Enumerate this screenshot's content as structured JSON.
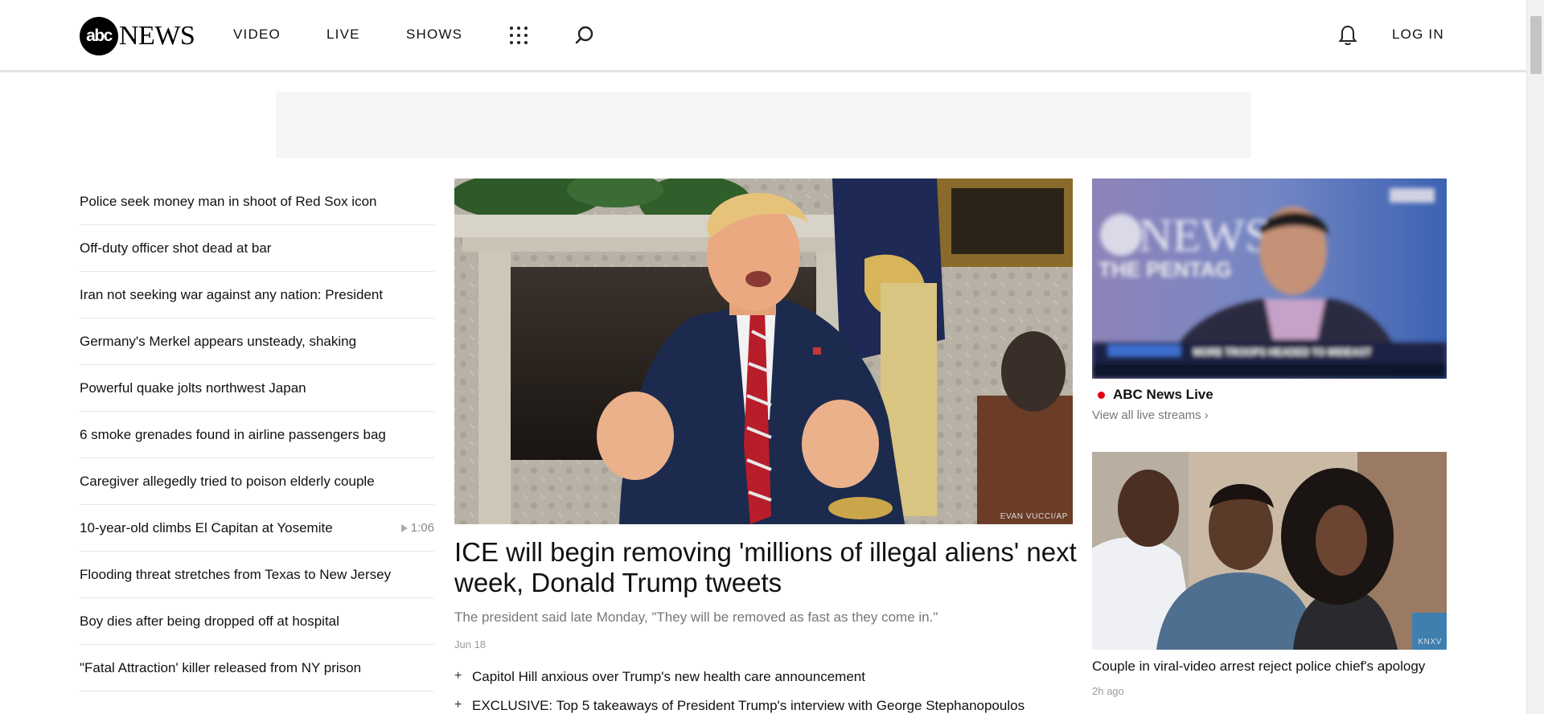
{
  "header": {
    "logo": {
      "circle_text": "abc",
      "wordmark": "NEWS"
    },
    "nav": [
      "VIDEO",
      "LIVE",
      "SHOWS"
    ],
    "login_label": "LOG IN"
  },
  "headlines": [
    {
      "title": "Police seek money man in shoot of Red Sox icon"
    },
    {
      "title": "Off-duty officer shot dead at bar"
    },
    {
      "title": "Iran not seeking war against any nation: President"
    },
    {
      "title": "Germany's Merkel appears unsteady, shaking"
    },
    {
      "title": "Powerful quake jolts northwest Japan"
    },
    {
      "title": "6 smoke grenades found in airline passengers bag"
    },
    {
      "title": "Caregiver allegedly tried to poison elderly couple"
    },
    {
      "title": "10-year-old climbs El Capitan at Yosemite",
      "duration": "1:06"
    },
    {
      "title": "Flooding threat stretches from Texas to New Jersey"
    },
    {
      "title": "Boy dies after being dropped off at hospital"
    },
    {
      "title": "\"Fatal Attraction' killer released from NY prison"
    }
  ],
  "main_story": {
    "photo_credit": "EVAN VUCCI/AP",
    "title": "ICE will begin removing 'millions of illegal aliens' next week, Donald Trump tweets",
    "summary": "The president said late Monday, \"They will be removed as fast as they come in.\"",
    "date": "Jun 18",
    "related": [
      "Capitol Hill anxious over Trump's new health care announcement",
      "EXCLUSIVE: Top 5 takeaways of President Trump's interview with George Stephanopoulos"
    ]
  },
  "right_column": {
    "live": {
      "overlay_text": "THE PENTAG",
      "ticker": "MORE TROOPS HEADED TO MIDEAST",
      "title": "ABC News Live",
      "link": "View all live streams ›"
    },
    "story": {
      "photo_credit": "KNXV",
      "title": "Couple in viral-video arrest reject police chief's apology",
      "time": "2h ago"
    }
  },
  "colors": {
    "live_dot": "#e3000f",
    "brand": "#000000"
  }
}
